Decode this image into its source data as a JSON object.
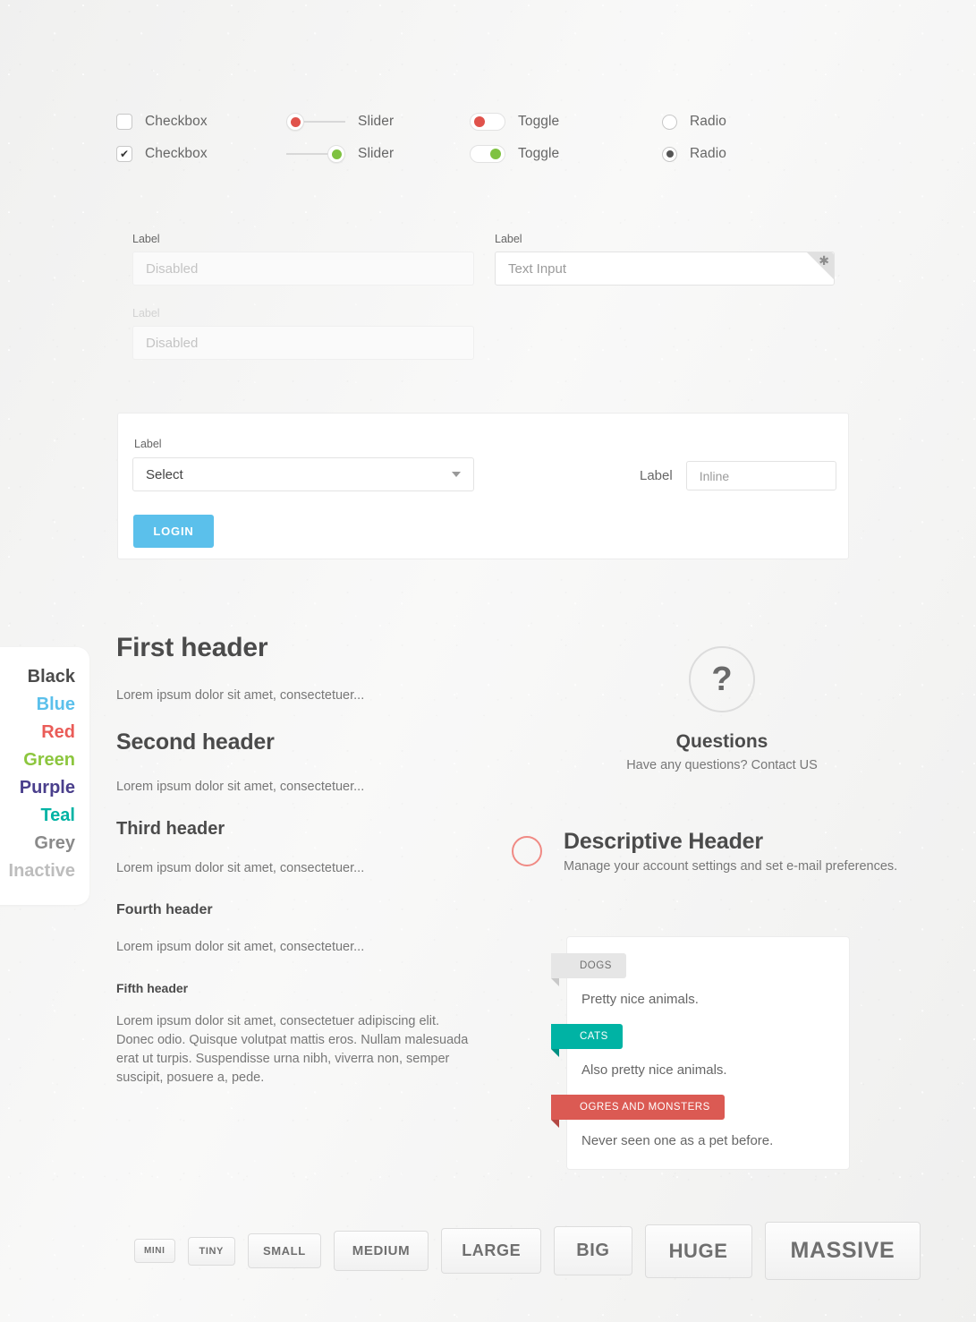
{
  "controls": {
    "rows": [
      {
        "checkbox": {
          "label": "Checkbox",
          "checked": false,
          "mark": ""
        },
        "slider": {
          "label": "Slider",
          "position": "left",
          "color": "#e0524b"
        },
        "toggle": {
          "label": "Toggle",
          "state": "off",
          "color": "#e0524b"
        },
        "radio": {
          "label": "Radio",
          "selected": false
        }
      },
      {
        "checkbox": {
          "label": "Checkbox",
          "checked": true,
          "mark": "✔"
        },
        "slider": {
          "label": "Slider",
          "position": "right",
          "color": "#7fc241"
        },
        "toggle": {
          "label": "Toggle",
          "state": "on",
          "color": "#7fc241"
        },
        "radio": {
          "label": "Radio",
          "selected": true
        }
      }
    ]
  },
  "inputs": {
    "left_top": {
      "label": "Label",
      "placeholder": "Disabled",
      "value": ""
    },
    "left_bottom": {
      "label": "Label",
      "placeholder": "Disabled",
      "value": ""
    },
    "right": {
      "label": "Label",
      "placeholder": "Text Input",
      "value": "",
      "required_marker": "✱"
    }
  },
  "panel": {
    "select": {
      "label": "Label",
      "value": "Select"
    },
    "login_button": "LOGIN",
    "inline": {
      "label": "Label",
      "placeholder": "Inline",
      "value": ""
    }
  },
  "palette": {
    "swatches": [
      {
        "name": "Black",
        "color": "#4b4b4b"
      },
      {
        "name": "Blue",
        "color": "#5bc0eb"
      },
      {
        "name": "Red",
        "color": "#ea5c58"
      },
      {
        "name": "Green",
        "color": "#8cc63e"
      },
      {
        "name": "Purple",
        "color": "#4a3f8c"
      },
      {
        "name": "Teal",
        "color": "#00b3a4"
      },
      {
        "name": "Grey",
        "color": "#8a8a8a"
      },
      {
        "name": "Inactive",
        "color": "#bdbdbd"
      }
    ]
  },
  "headers": {
    "items": [
      {
        "title": "First header",
        "body": "Lorem ipsum dolor sit amet, consectetuer..."
      },
      {
        "title": "Second header",
        "body": "Lorem ipsum dolor sit amet, consectetuer..."
      },
      {
        "title": "Third header",
        "body": "Lorem ipsum dolor sit amet, consectetuer..."
      },
      {
        "title": "Fourth header",
        "body": "Lorem ipsum dolor sit amet, consectetuer..."
      },
      {
        "title": "Fifth header",
        "body": "Lorem ipsum dolor sit amet, consectetuer adipiscing elit. Donec odio. Quisque volutpat mattis eros. Nullam malesuada erat ut turpis. Suspendisse urna nibh, viverra non, semper suscipit, posuere a, pede."
      }
    ]
  },
  "questions": {
    "icon": "?",
    "title": "Questions",
    "subtitle": "Have any questions? Contact US"
  },
  "descriptive": {
    "title": "Descriptive Header",
    "subtitle": "Manage your account settings and set e-mail preferences."
  },
  "ribbon_card": {
    "entries": [
      {
        "tag": "DOGS",
        "bg": "#e6e6e6",
        "fold": "#c9c9c9",
        "text_color": "#6f6f6f",
        "text": "Pretty nice animals."
      },
      {
        "tag": "CATS",
        "bg": "#00b3a4",
        "fold": "#009083",
        "text_color": "#ffffff",
        "text": "Also pretty nice animals."
      },
      {
        "tag": "OGRES AND MONSTERS",
        "bg": "#db5a53",
        "fold": "#b34843",
        "text_color": "#ffffff",
        "text": "Never seen one as a pet before."
      }
    ]
  },
  "sizes": {
    "buttons": [
      "MINI",
      "TINY",
      "SMALL",
      "MEDIUM",
      "LARGE",
      "BIG",
      "HUGE",
      "MASSIVE"
    ]
  }
}
